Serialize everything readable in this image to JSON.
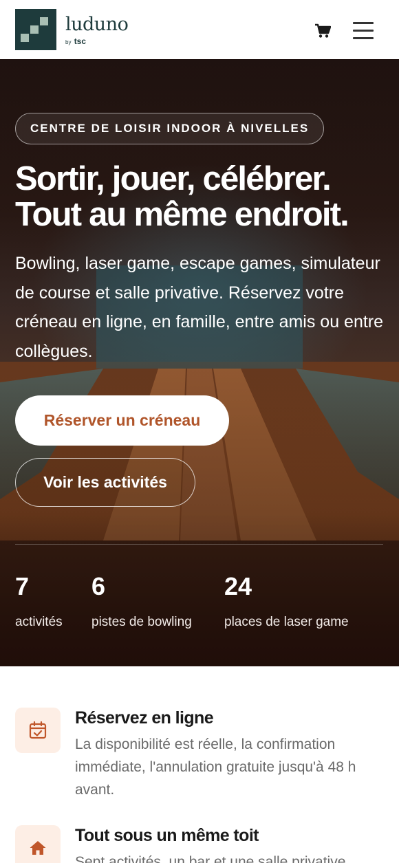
{
  "brand": {
    "name": "luduno",
    "by": "by",
    "sub": "tsc"
  },
  "header": {
    "cart_icon": "shopping-cart-icon",
    "menu_icon": "hamburger-menu-icon"
  },
  "hero": {
    "tag": "CENTRE DE LOISIR INDOOR À NIVELLES",
    "title_line1": "Sortir, jouer, célébrer.",
    "title_line2": "Tout au même endroit.",
    "description": "Bowling, laser game, escape games, simulateur de course et salle privative. Réservez votre créneau en ligne, en famille, entre amis ou entre collègues.",
    "primary_cta": "Réserver un créneau",
    "secondary_cta": "Voir les activités",
    "stats": [
      {
        "value": "7",
        "label": "activités"
      },
      {
        "value": "6",
        "label": "pistes de bowling"
      },
      {
        "value": "24",
        "label": "places de laser game"
      }
    ]
  },
  "features": [
    {
      "icon": "calendar-check-icon",
      "title": "Réservez en ligne",
      "description": "La disponibilité est réelle, la confirmation immédiate, l'annulation gratuite jusqu'à 48 h avant."
    },
    {
      "icon": "home-icon",
      "title": "Tout sous un même toit",
      "description": "Sept activités, un bar et une salle privative"
    }
  ],
  "colors": {
    "accent": "#b0552a",
    "brand_dark": "#1e3b3c",
    "icon_bg": "#fdeee5",
    "icon_fg": "#c0562a"
  }
}
